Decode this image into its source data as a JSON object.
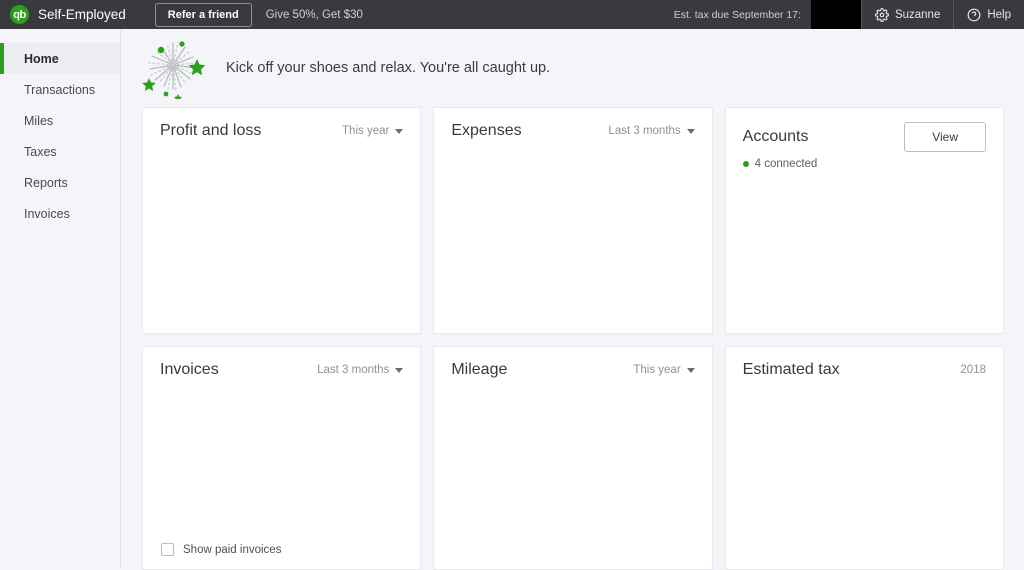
{
  "topbar": {
    "logo_text": "qb",
    "logo_icon": "quickbooks-logo-icon",
    "brand_name": "Self-Employed",
    "refer_label": "Refer a friend",
    "give_text": "Give 50%, Get $30",
    "tax_due_label": "Est. tax due September 17:",
    "tax_due_value": "",
    "settings_label": "Suzanne",
    "settings_icon": "gear-icon",
    "help_label": "Help",
    "help_icon": "help-circle-icon",
    "background_color": "#393a3d",
    "accent_color": "#2ca01c"
  },
  "sidebar": {
    "items": [
      {
        "label": "Home",
        "active": true
      },
      {
        "label": "Transactions",
        "active": false
      },
      {
        "label": "Miles",
        "active": false
      },
      {
        "label": "Taxes",
        "active": false
      },
      {
        "label": "Reports",
        "active": false
      },
      {
        "label": "Invoices",
        "active": false
      }
    ]
  },
  "banner": {
    "icon": "firework-burst-icon",
    "message": "Kick off your shoes and relax. You're all caught up."
  },
  "cards": {
    "profit_and_loss": {
      "title": "Profit and loss",
      "period": "This year"
    },
    "expenses": {
      "title": "Expenses",
      "period": "Last 3 months"
    },
    "accounts": {
      "title": "Accounts",
      "view_label": "View",
      "status": "4 connected",
      "status_color": "#2ca01c"
    },
    "invoices": {
      "title": "Invoices",
      "period": "Last 3 months",
      "show_paid_label": "Show paid invoices",
      "show_paid_checked": false
    },
    "mileage": {
      "title": "Mileage",
      "period": "This year"
    },
    "estimated_tax": {
      "title": "Estimated tax",
      "period": "2018"
    }
  }
}
